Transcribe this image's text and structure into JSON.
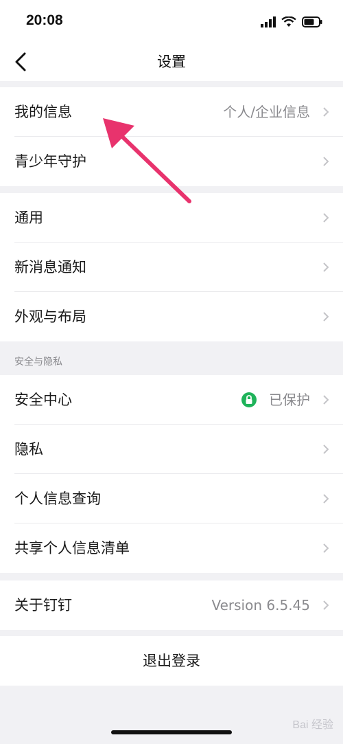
{
  "status": {
    "time": "20:08"
  },
  "nav": {
    "title": "设置"
  },
  "groups": {
    "g1": [
      {
        "label": "我的信息",
        "value": "个人/企业信息"
      },
      {
        "label": "青少年守护"
      }
    ],
    "g2": [
      {
        "label": "通用"
      },
      {
        "label": "新消息通知"
      },
      {
        "label": "外观与布局"
      }
    ],
    "security_header": "安全与隐私",
    "g3": [
      {
        "label": "安全中心",
        "value": "已保护"
      },
      {
        "label": "隐私"
      },
      {
        "label": "个人信息查询"
      },
      {
        "label": "共享个人信息清单"
      }
    ],
    "g4": [
      {
        "label": "关于钉钉",
        "value": "Version 6.5.45"
      }
    ]
  },
  "logout_label": "退出登录",
  "watermark": "Bai 经验",
  "colors": {
    "accent_arrow": "#e8336d",
    "lock_green": "#1fb35a"
  }
}
